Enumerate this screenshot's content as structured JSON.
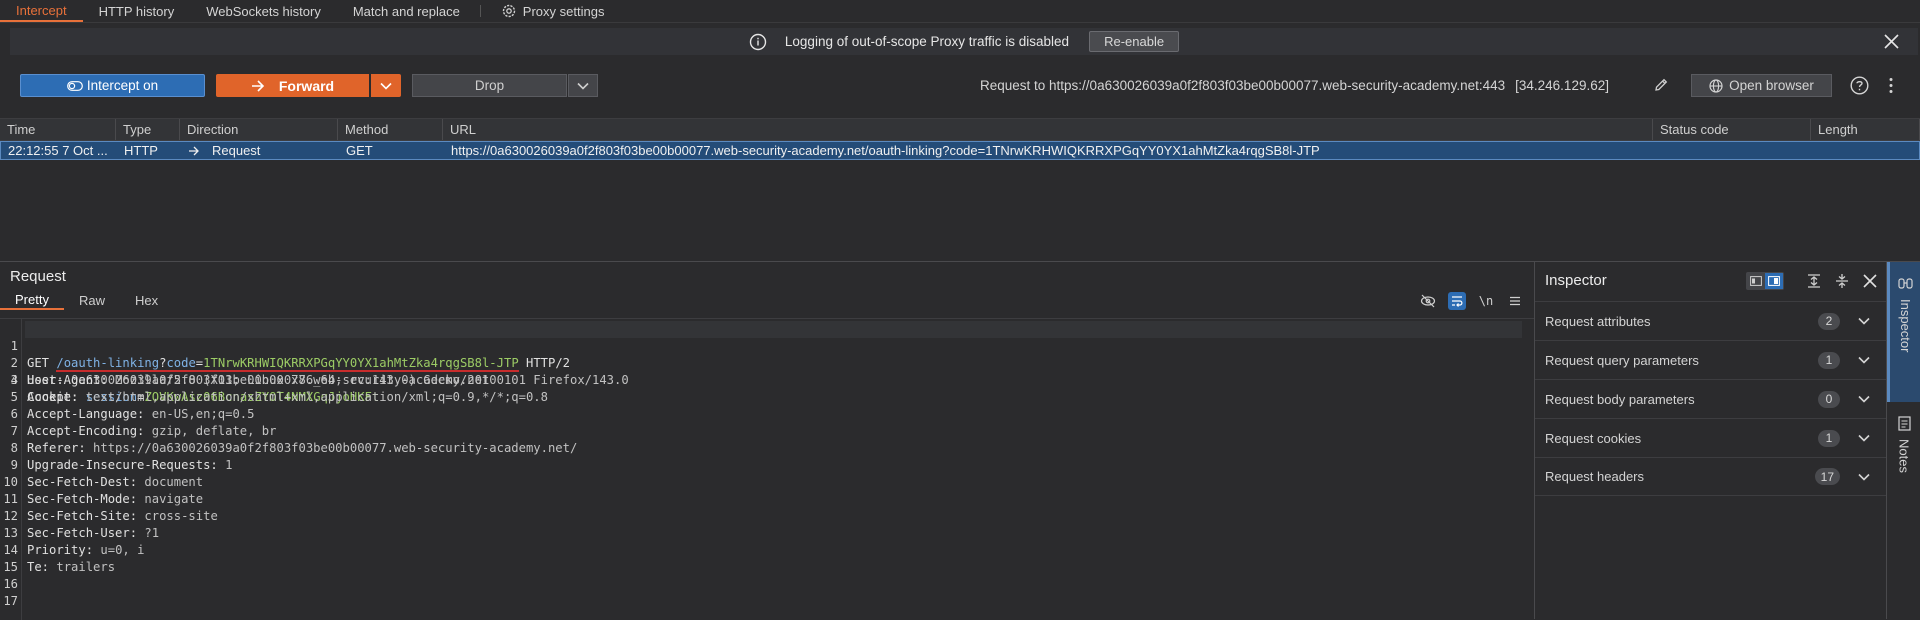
{
  "tabs": [
    {
      "label": "Intercept"
    },
    {
      "label": "HTTP history"
    },
    {
      "label": "WebSockets history"
    },
    {
      "label": "Match and replace"
    },
    {
      "label": "Proxy settings"
    }
  ],
  "banner": {
    "text": "Logging of out-of-scope Proxy traffic is disabled",
    "button": "Re-enable"
  },
  "toolbar": {
    "intercept_label": "Intercept on",
    "forward_label": "Forward",
    "drop_label": "Drop",
    "request_to": "Request to https://0a630026039a0f2f803f03be00b00077.web-security-academy.net:443",
    "ip": "[34.246.129.62]",
    "open_browser": "Open browser"
  },
  "history": {
    "columns": [
      "Time",
      "Type",
      "Direction",
      "Method",
      "URL",
      "Status code",
      "Length"
    ],
    "rows": [
      {
        "time": "22:12:55 7 Oct ...",
        "type": "HTTP",
        "direction": "Request",
        "method": "GET",
        "url": "https://0a630026039a0f2f803f03be00b00077.web-security-academy.net/oauth-linking?code=1TNrwKRHWIQKRRXPGqYY0YX1ahMtZka4rqgSB8l-JTP",
        "status": "",
        "length": ""
      }
    ]
  },
  "request": {
    "title": "Request",
    "subtabs": [
      "Pretty",
      "Raw",
      "Hex"
    ],
    "newline_tool": "\\n",
    "lines": [
      {
        "n": "1",
        "method": "GET",
        "path": "/oauth-linking",
        "q": "?",
        "param": "code",
        "eq": "=",
        "val": "1TNrwKRHWIQKRRXPGqYY0YX1ahMtZka4rqgSB8l-JTP",
        "proto": "HTTP/2"
      },
      {
        "n": "2",
        "key": "Host:",
        "value": "0a630026039a0f2f803f03be00b00077.web-security-academy.net"
      },
      {
        "n": "3",
        "key": "Cookie:",
        "cookie_name": "session",
        "cookie_eq": "=",
        "cookie_val": "ZOVKwAsz06BcnasZYOT4NMXGqJjoHKFt"
      },
      {
        "n": "4",
        "key": "User-Agent:",
        "value": "Mozilla/5.0 (X11; Linux x86_64; rv:143.0) Gecko/20100101 Firefox/143.0"
      },
      {
        "n": "5",
        "key": "Accept:",
        "value": "text/html,application/xhtml+xml,application/xml;q=0.9,*/*;q=0.8"
      },
      {
        "n": "6",
        "key": "Accept-Language:",
        "value": "en-US,en;q=0.5"
      },
      {
        "n": "7",
        "key": "Accept-Encoding:",
        "value": "gzip, deflate, br"
      },
      {
        "n": "8",
        "key": "Referer:",
        "value": "https://0a630026039a0f2f803f03be00b00077.web-security-academy.net/"
      },
      {
        "n": "9",
        "key": "Upgrade-Insecure-Requests:",
        "value": "1"
      },
      {
        "n": "10",
        "key": "Sec-Fetch-Dest:",
        "value": "document"
      },
      {
        "n": "11",
        "key": "Sec-Fetch-Mode:",
        "value": "navigate"
      },
      {
        "n": "12",
        "key": "Sec-Fetch-Site:",
        "value": "cross-site"
      },
      {
        "n": "13",
        "key": "Sec-Fetch-User:",
        "value": "?1"
      },
      {
        "n": "14",
        "key": "Priority:",
        "value": "u=0, i"
      },
      {
        "n": "15",
        "key": "Te:",
        "value": "trailers"
      },
      {
        "n": "16"
      },
      {
        "n": "17"
      }
    ]
  },
  "inspector": {
    "title": "Inspector",
    "items": [
      {
        "label": "Request attributes",
        "count": "2"
      },
      {
        "label": "Request query parameters",
        "count": "1"
      },
      {
        "label": "Request body parameters",
        "count": "0"
      },
      {
        "label": "Request cookies",
        "count": "1"
      },
      {
        "label": "Request headers",
        "count": "17"
      }
    ]
  },
  "sidebar": {
    "inspector_label": "Inspector",
    "notes_label": "Notes"
  },
  "colors": {
    "accent_orange": "#e0642a",
    "accent_blue": "#2d6db4",
    "underline_red": "#c82c2c",
    "param_value_green": "#9ccc65"
  }
}
